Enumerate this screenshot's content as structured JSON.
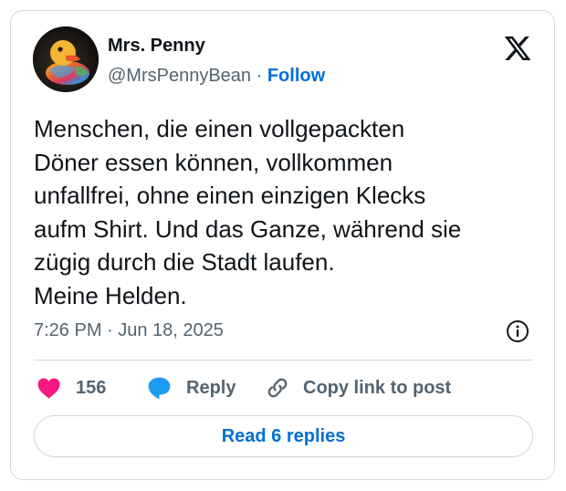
{
  "author": {
    "name": "Mrs. Penny",
    "handle": "@MrsPennyBean",
    "separator": " · ",
    "follow_label": "Follow",
    "avatar_icon": "rubber-duck-avatar"
  },
  "brand": {
    "logo_icon": "x-logo-icon"
  },
  "tweet": {
    "text": "Menschen, die einen vollgepackten\nDöner essen können, vollkommen\nunfallfrei, ohne einen einzigen Klecks\naufm Shirt. Und das Ganze, während sie\nzügig durch die Stadt laufen.\nMeine Helden."
  },
  "meta": {
    "timestamp": "7:26 PM · Jun 18, 2025",
    "info_icon": "info-icon"
  },
  "actions": {
    "like_count": "156",
    "reply_label": "Reply",
    "copy_link_label": "Copy link to post"
  },
  "footer": {
    "read_replies_label": "Read 6 replies"
  },
  "colors": {
    "accent": "#006fd6",
    "like": "#f91880",
    "reply": "#1d9bf0",
    "muted": "#536471",
    "text": "#0f1419",
    "border": "#cfd9de"
  }
}
